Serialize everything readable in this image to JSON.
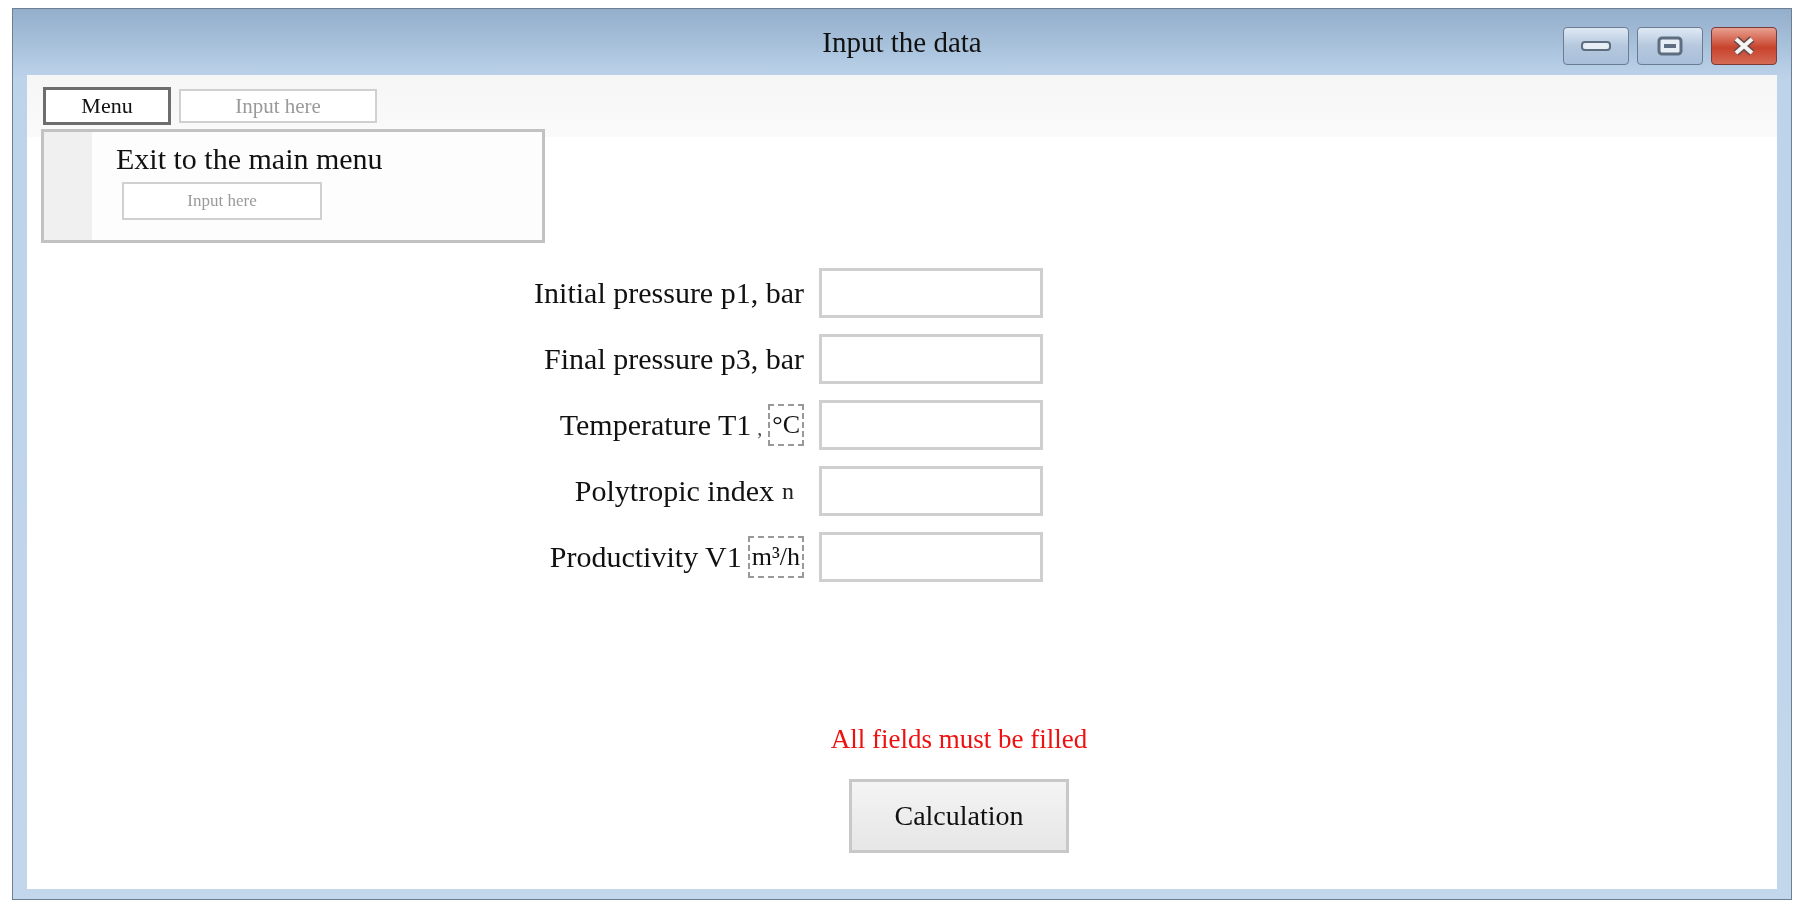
{
  "window": {
    "title": "Input the data"
  },
  "menu_bar": {
    "menu": {
      "label": "Menu",
      "expanded": true
    },
    "field": {
      "placeholder": "Input here"
    }
  },
  "dropdown": {
    "items": [
      {
        "label": "Exit to the main menu"
      }
    ],
    "field": {
      "placeholder": "Input here"
    }
  },
  "fields": [
    {
      "kind": "plain",
      "label": "Initial pressure p1, bar"
    },
    {
      "kind": "plain",
      "label": "Final pressure p3, bar"
    },
    {
      "kind": "boxed",
      "label": "Temperature T1",
      "separator": ",",
      "unit": "°C"
    },
    {
      "kind": "suffix",
      "label": "Polytropic index",
      "unit": "n"
    },
    {
      "kind": "boxed",
      "label": "Productivity V1",
      "unit": "m³/h"
    }
  ],
  "error": "All fields must be filled",
  "button": "Calculation"
}
